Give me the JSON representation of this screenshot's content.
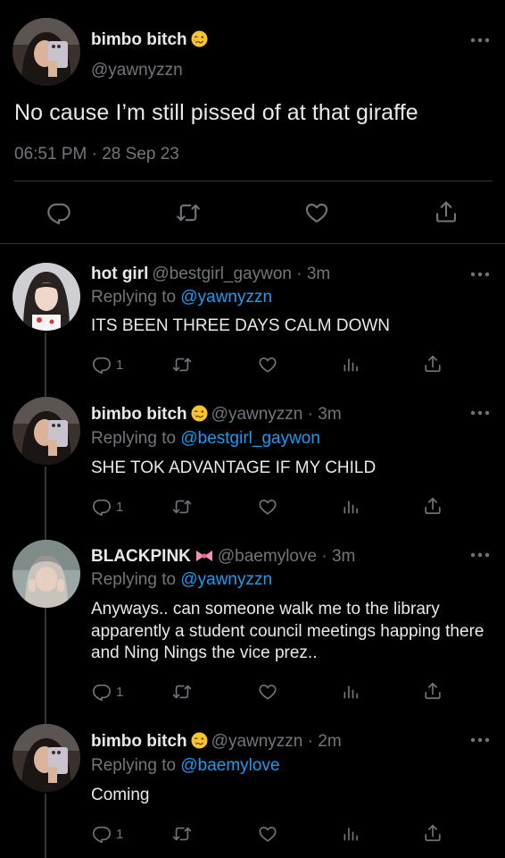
{
  "main_tweet": {
    "display_name": "bimbo bitch",
    "name_emoji": "woozy-face-emoji",
    "handle": "@yawnyzzn",
    "text": "No cause I’m still pissed of at that giraffe",
    "timestamp": "06:51 PM · 28 Sep 23",
    "actions": [
      "reply-icon",
      "retweet-icon",
      "like-icon",
      "share-icon"
    ]
  },
  "replies": [
    {
      "display_name": "hot girl",
      "handle_time": "@bestgirl_gaywon · 3m",
      "replying_prefix": "Replying to",
      "replying_to": "@yawnyzzn",
      "text": "ITS BEEN THREE DAYS CALM DOWN",
      "reply_count": "1"
    },
    {
      "display_name": "bimbo bitch",
      "name_emoji": "woozy-face-emoji",
      "handle_time": "@yawnyzzn · 3m",
      "replying_prefix": "Replying to",
      "replying_to": "@bestgirl_gaywon",
      "text": "SHE TOK ADVANTAGE IF MY CHILD",
      "reply_count": "1"
    },
    {
      "display_name": "BLACKPINK",
      "name_emoji": "ribbon-emoji",
      "handle_time": "@baemylove · 3m",
      "replying_prefix": "Replying to",
      "replying_to": "@yawnyzzn",
      "text": "Anyways.. can someone walk me to the library apparently a student council meetings happing there and Ning Nings the vice prez..",
      "reply_count": "1"
    },
    {
      "display_name": "bimbo bitch",
      "name_emoji": "woozy-face-emoji",
      "handle_time": "@yawnyzzn · 2m",
      "replying_prefix": "Replying to",
      "replying_to": "@baemylove",
      "text": "Coming",
      "reply_count": "1"
    }
  ],
  "colors": {
    "background": "#000000",
    "text": "#e7e9ea",
    "secondary": "#71767b",
    "link": "#1d9bf0",
    "divider": "#2f3336"
  }
}
